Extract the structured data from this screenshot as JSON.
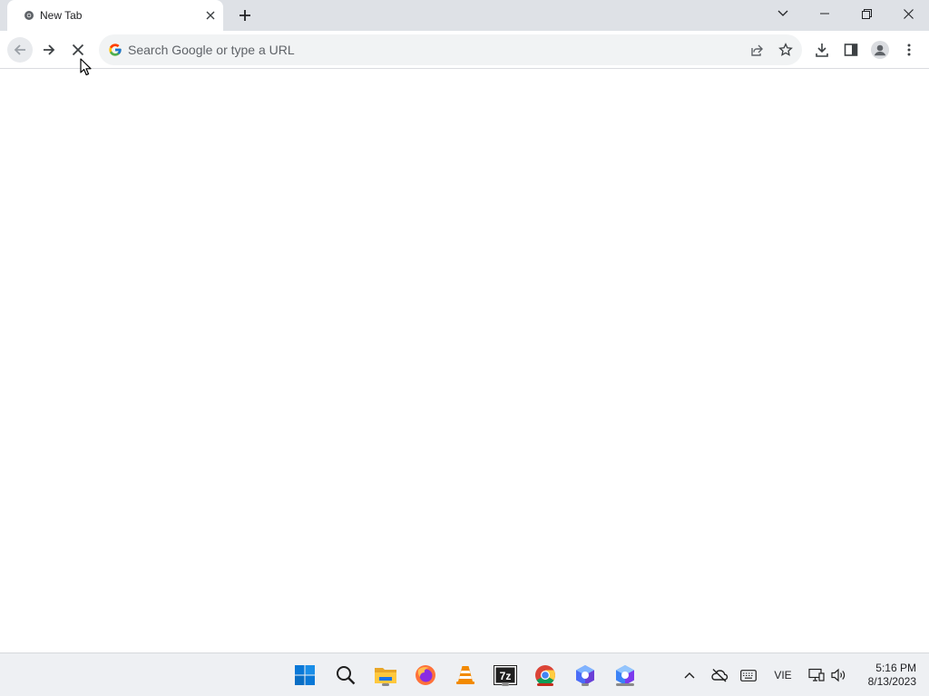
{
  "tab": {
    "title": "New Tab"
  },
  "omnibox": {
    "placeholder": "Search Google or type a URL",
    "value": ""
  },
  "taskbar": {
    "apps": [
      "windows-start",
      "search",
      "file-explorer",
      "firefox",
      "vlc",
      "7zip",
      "chrome",
      "app-1",
      "app-2"
    ],
    "language": "VIE",
    "time": "5:16 PM",
    "date": "8/13/2023"
  },
  "colors": {
    "tabstrip": "#dee1e6",
    "omnibox": "#f1f3f4",
    "taskbar": "#eef0f3",
    "active_indicator": "#c42b1c"
  }
}
